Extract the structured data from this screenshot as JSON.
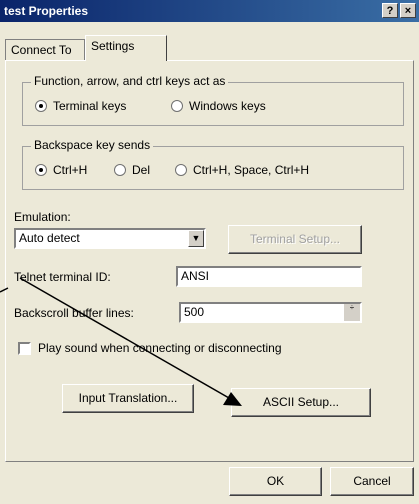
{
  "window": {
    "title": "test Properties",
    "help_label": "?",
    "close_label": "×"
  },
  "tabs": [
    {
      "label": "Connect To",
      "active": false
    },
    {
      "label": "Settings",
      "active": true
    }
  ],
  "function_keys": {
    "legend": "Function, arrow, and ctrl keys act as",
    "options": [
      {
        "label": "Terminal keys",
        "selected": true
      },
      {
        "label": "Windows keys",
        "selected": false
      }
    ]
  },
  "backspace": {
    "legend": "Backspace key sends",
    "options": [
      {
        "label": "Ctrl+H",
        "selected": true
      },
      {
        "label": "Del",
        "selected": false
      },
      {
        "label": "Ctrl+H, Space, Ctrl+H",
        "selected": false
      }
    ]
  },
  "emulation": {
    "label": "Emulation:",
    "value": "Auto detect",
    "dropdown_glyph": "▼",
    "terminal_setup_label": "Terminal Setup..."
  },
  "telnet": {
    "label": "Telnet terminal ID:",
    "value": "ANSI"
  },
  "backscroll": {
    "label": "Backscroll buffer lines:",
    "value": "500",
    "spin_glyph": "÷"
  },
  "play_sound": {
    "label": "Play sound when connecting or disconnecting",
    "checked": false
  },
  "buttons": {
    "input_translation": "Input Translation...",
    "ascii_setup": "ASCII Setup...",
    "ok": "OK",
    "cancel": "Cancel"
  },
  "annotation": {
    "arrow_color": "#000000"
  }
}
